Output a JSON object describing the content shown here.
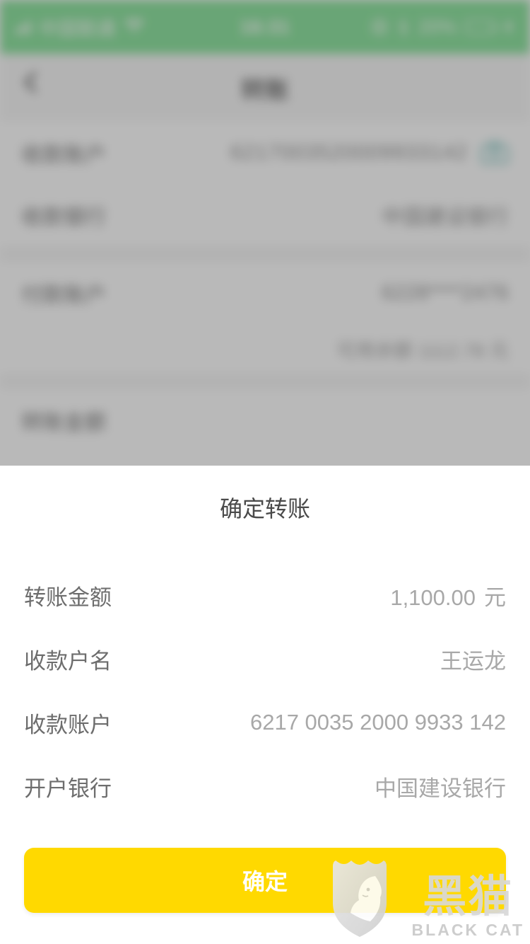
{
  "status_bar": {
    "carrier": "中国联通",
    "time": "16:31",
    "battery_pct": "20%",
    "signal_icon": "signal-bars-icon",
    "wifi_icon": "wifi-icon",
    "rotation_lock_icon": "rotation-lock-icon",
    "bluetooth_icon": "bluetooth-icon",
    "battery_icon": "battery-icon",
    "charging_icon": "charging-bolt-icon",
    "background_color": "#4ed36a"
  },
  "background_page": {
    "nav_title": "转账",
    "back_icon": "back-chevron-icon",
    "rows": [
      {
        "label": "收款账户",
        "value": "6217003520009933142",
        "icon": "camera-scan-icon"
      },
      {
        "label": "收款银行",
        "value": "中国建设银行"
      },
      {
        "label": "付款账户",
        "value": "6228****2476"
      },
      {
        "label": "转账金额",
        "value": ""
      }
    ],
    "balance_text": "可用余额 1112.78 元"
  },
  "sheet": {
    "title": "确定转账",
    "rows": [
      {
        "label": "转账金额",
        "value": "1,100.00",
        "unit": "元"
      },
      {
        "label": "收款户名",
        "value": "王运龙",
        "unit": ""
      },
      {
        "label": "收款账户",
        "value": "6217 0035 2000 9933 142",
        "unit": ""
      },
      {
        "label": "开户银行",
        "value": "中国建设银行",
        "unit": ""
      }
    ],
    "confirm_label": "确定",
    "confirm_color": "#ffd900"
  },
  "watermark": {
    "cn": "黑猫",
    "en": "BLACK CAT",
    "icon": "black-cat-shield-icon"
  }
}
